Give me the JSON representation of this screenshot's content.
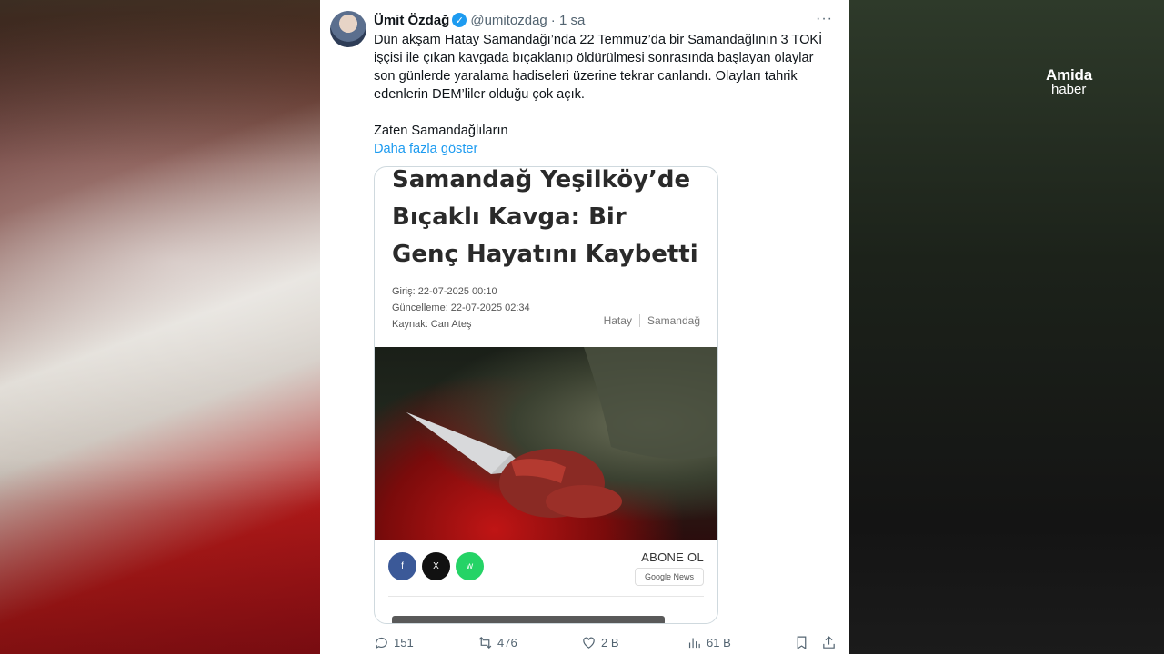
{
  "brand": {
    "line1": "Amida",
    "line2": "haber"
  },
  "tweet": {
    "author_name": "Ümit Özdağ",
    "handle": "@umitozdag",
    "time": "· 1 sa",
    "more_label": "···",
    "text_lines": [
      "Dün akşam Hatay Samandağı’nda 22 Temmuz’da bir Samandağlının 3 TOKİ",
      "işçisi ile çıkan kavgada bıçaklanıp öldürülmesi sonrasında başlayan olaylar",
      "son günlerde yaralama hadiseleri üzerine tekrar canlandı. Olayları tahrik",
      "edenlerin DEM’liler olduğu çok açık."
    ],
    "second_paragraph": "Zaten Samandağlıların",
    "show_more": "Daha fazla göster"
  },
  "article": {
    "headline_lines": [
      "Samandağ Yeşilköy’de",
      "Bıçaklı Kavga: Bir",
      "Genç Hayatını Kaybetti"
    ],
    "meta": {
      "entry": "Giriş: 22-07-2025 00:10",
      "updated": "Güncelleme: 22-07-2025 02:34",
      "source": "Kaynak: Can Ateş"
    },
    "categories": [
      "Hatay",
      "Samandağ"
    ],
    "subscribe": "ABONE OL",
    "google_news": "Google News",
    "social_icons": [
      "facebook-icon",
      "x-icon",
      "whatsapp-icon"
    ]
  },
  "actions": {
    "replies": "151",
    "reposts": "476",
    "likes": "2 B",
    "views": "61 B"
  },
  "colors": {
    "accent": "#1d9bf0",
    "text": "#0f1419",
    "muted": "#536471"
  }
}
